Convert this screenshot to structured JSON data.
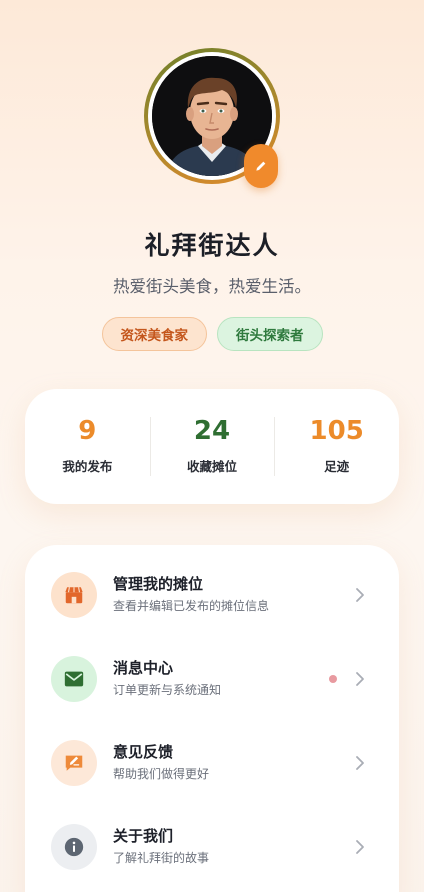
{
  "profile": {
    "name": "礼拜街达人",
    "bio": "热爱街头美食，热爱生活。",
    "tags": [
      "资深美食家",
      "街头探索者"
    ],
    "avatar_icon": "user-portrait",
    "edit_icon": "pencil-icon"
  },
  "stats": [
    {
      "value": "9",
      "label": "我的发布",
      "color": "#ec8b2a"
    },
    {
      "value": "24",
      "label": "收藏摊位",
      "color": "#2f6e32"
    },
    {
      "value": "105",
      "label": "足迹",
      "color": "#ec8b2a"
    }
  ],
  "menu": [
    {
      "title": "管理我的摊位",
      "subtitle": "查看并编辑已发布的摊位信息",
      "icon": "store-icon",
      "has_dot": false
    },
    {
      "title": "消息中心",
      "subtitle": "订单更新与系统通知",
      "icon": "mail-icon",
      "has_dot": true
    },
    {
      "title": "意见反馈",
      "subtitle": "帮助我们做得更好",
      "icon": "feedback-icon",
      "has_dot": false
    },
    {
      "title": "关于我们",
      "subtitle": "了解礼拜街的故事",
      "icon": "info-icon",
      "has_dot": false
    }
  ],
  "colors": {
    "accent": "#f08a2c",
    "green": "#2f6e32",
    "badge_dot": "#e89aa0"
  }
}
